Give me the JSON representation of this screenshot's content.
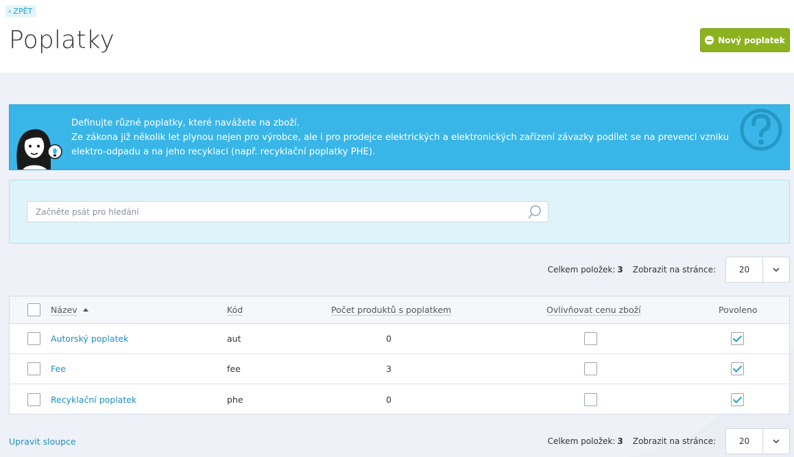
{
  "header": {
    "back_label": "ZPĚT",
    "title": "Poplatky",
    "new_button_label": "Nový poplatek"
  },
  "info": {
    "line1": "Definujte různé poplatky, které navážete na zboží.",
    "line2": "Ze zákona již několik let plynou nejen pro výrobce, ale i pro prodejce elektrických a elektronických zařízení závazky podílet se na prevenci vzniku",
    "line3": "elektro-odpadu a na jeho recyklaci (např. recyklační poplatky PHE)."
  },
  "search": {
    "placeholder": "Začněte psát pro hledání"
  },
  "pager": {
    "total_label": "Celkem položek:",
    "total_value": "3",
    "per_page_label": "Zobrazit na stránce:",
    "per_page_value": "20"
  },
  "table": {
    "columns": {
      "name": "Název",
      "code": "Kód",
      "products_count": "Počet produktů s poplatkem",
      "affects_price": "Ovlivňovat cenu zboží",
      "enabled": "Povoleno"
    },
    "rows": [
      {
        "name": "Autorský poplatek",
        "code": "aut",
        "count": "0",
        "affects_price": false,
        "enabled": true
      },
      {
        "name": "Fee",
        "code": "fee",
        "count": "3",
        "affects_price": false,
        "enabled": true
      },
      {
        "name": "Recyklační poplatek",
        "code": "phe",
        "count": "0",
        "affects_price": false,
        "enabled": true
      }
    ]
  },
  "footer": {
    "edit_columns_label": "Upravit sloupce"
  },
  "colors": {
    "accent_green": "#8cb31f",
    "info_blue": "#39b6e7",
    "link_blue": "#1e8fbc"
  },
  "icons": [
    "chevron-left-icon",
    "plus-circle-icon",
    "mascot-illustration",
    "question-mark-icon",
    "search-icon",
    "sort-ascending-icon",
    "chevron-down-icon",
    "checkbox-icon"
  ]
}
